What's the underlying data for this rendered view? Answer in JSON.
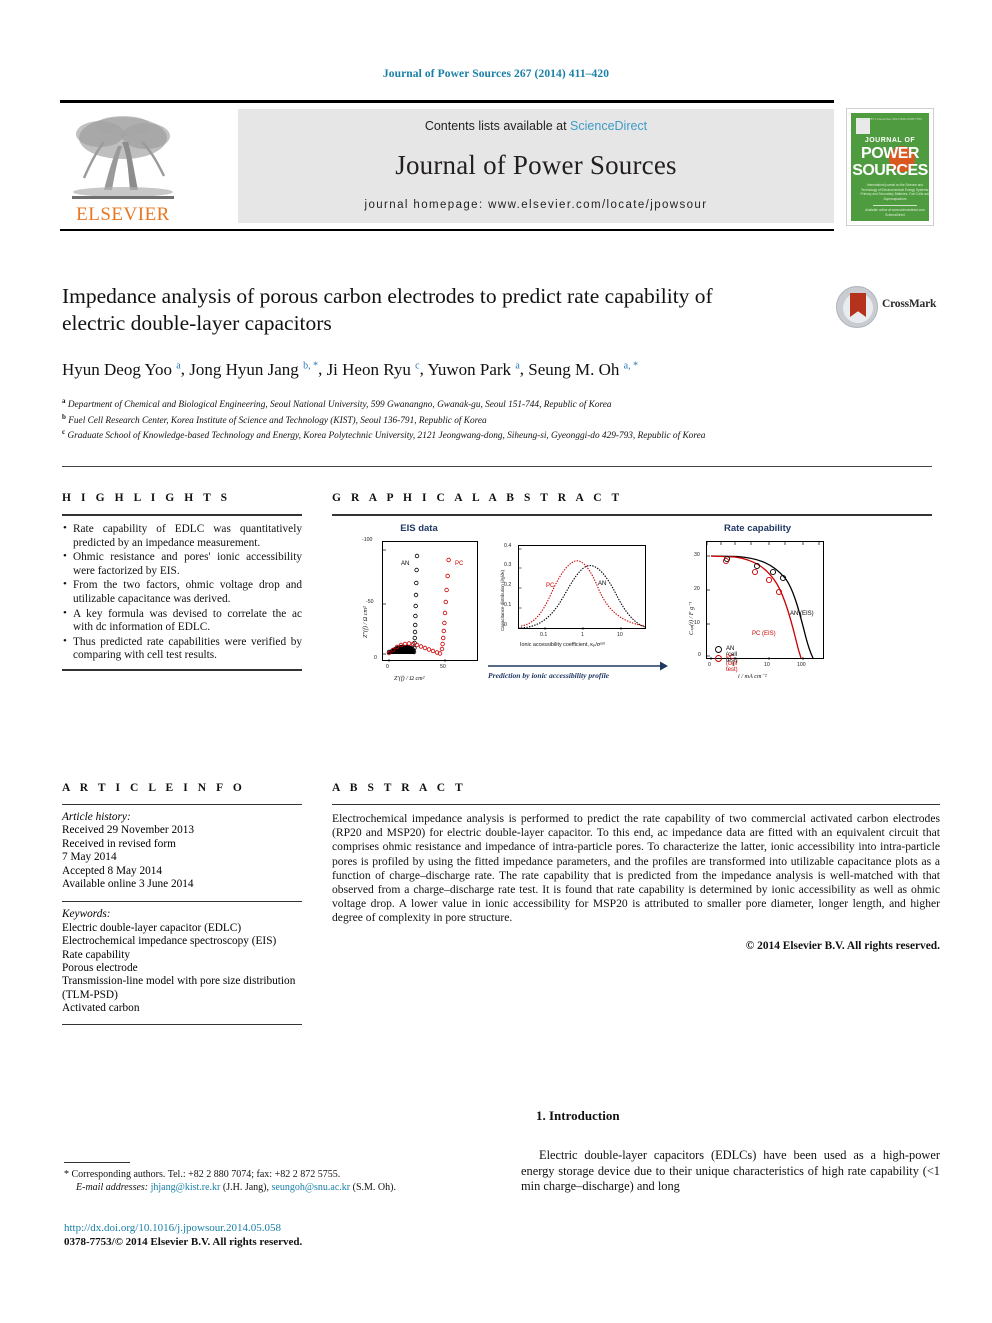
{
  "running_head": "Journal of Power Sources 267 (2014) 411–420",
  "masthead": {
    "contents_prefix": "Contents lists available at ",
    "sciencedirect": "ScienceDirect",
    "journal_name": "Journal of Power Sources",
    "homepage": "journal homepage: www.elsevier.com/locate/jpowsour",
    "publisher_logo_text": "ELSEVIER",
    "cover": {
      "top_text": "Volume 267  1 December 2014  ISSN 0378-7753",
      "journal_of": "JOURNAL OF",
      "power": "POWER",
      "sources": "SOURCES",
      "subtitle": "International journal on the Science and Technology of Electrochemical Energy Systems: Primary and Secondary Batteries, Fuel Cells and Supercapacitors",
      "footer": "Available online at www.sciencedirect.com  ScienceDirect"
    }
  },
  "article": {
    "title": "Impedance analysis of porous carbon electrodes to predict rate capability of electric double-layer capacitors",
    "authors": [
      {
        "name": "Hyun Deog Yoo",
        "marks": "a"
      },
      {
        "name": "Jong Hyun Jang",
        "marks": "b, *"
      },
      {
        "name": "Ji Heon Ryu",
        "marks": "c"
      },
      {
        "name": "Yuwon Park",
        "marks": "a"
      },
      {
        "name": "Seung M. Oh",
        "marks": "a, *"
      }
    ],
    "affiliations": [
      {
        "mark": "a",
        "text": "Department of Chemical and Biological Engineering, Seoul National University, 599 Gwanangno, Gwanak-gu, Seoul 151-744, Republic of Korea"
      },
      {
        "mark": "b",
        "text": "Fuel Cell Research Center, Korea Institute of Science and Technology (KIST), Seoul 136-791, Republic of Korea"
      },
      {
        "mark": "c",
        "text": "Graduate School of Knowledge-based Technology and Energy, Korea Polytechnic University, 2121 Jeongwang-dong, Siheung-si, Gyeonggi-do 429-793, Republic of Korea"
      }
    ],
    "crossmark_label": "CrossMark"
  },
  "highlights": {
    "heading": "H I G H L I G H T S",
    "items": [
      "Rate capability of EDLC was quantitatively predicted by an impedance measurement.",
      "Ohmic resistance and pores' ionic accessibility were factorized by EIS.",
      "From the two factors, ohmic voltage drop and utilizable capacitance was derived.",
      "A key formula was devised to correlate the ac with dc information of EDLC.",
      "Thus predicted rate capabilities were verified by comparing with cell test results."
    ]
  },
  "graphical_abstract": {
    "heading": "G R A P H I C A L   A B S T R A C T",
    "arrow_caption": "Prediction by ionic accessibility profile"
  },
  "article_info": {
    "heading": "A R T I C L E   I N F O",
    "history_label": "Article history:",
    "history": [
      "Received 29 November 2013",
      "Received in revised form",
      "7 May 2014",
      "Accepted 8 May 2014",
      "Available online 3 June 2014"
    ],
    "keywords_label": "Keywords:",
    "keywords": [
      "Electric double-layer capacitor (EDLC)",
      "Electrochemical impedance spectroscopy (EIS)",
      "Rate capability",
      "Porous electrode",
      "Transmission-line model with pore size distribution (TLM-PSD)",
      "Activated carbon"
    ]
  },
  "abstract": {
    "heading": "A B S T R A C T",
    "body": "Electrochemical impedance analysis is performed to predict the rate capability of two commercial activated carbon electrodes (RP20 and MSP20) for electric double-layer capacitor. To this end, ac impedance data are fitted with an equivalent circuit that comprises ohmic resistance and impedance of intra-particle pores. To characterize the latter, ionic accessibility into intra-particle pores is profiled by using the fitted impedance parameters, and the profiles are transformed into utilizable capacitance plots as a function of charge–discharge rate. The rate capability that is predicted from the impedance analysis is well-matched with that observed from a charge–discharge rate test. It is found that rate capability is determined by ionic accessibility as well as ohmic voltage drop. A lower value in ionic accessibility for MSP20 is attributed to smaller pore diameter, longer length, and higher degree of complexity in pore structure.",
    "copyright": "© 2014 Elsevier B.V. All rights reserved."
  },
  "footnotes": {
    "corresponding": "Corresponding authors. Tel.: +82 2 880 7074; fax: +82 2 872 5755.",
    "email_label": "E-mail addresses:",
    "email1": "jhjang@kist.re.kr",
    "email1_who": "(J.H. Jang),",
    "email2": "seungoh@snu.ac.kr",
    "email2_who": "(S.M. Oh).",
    "doi": "http://dx.doi.org/10.1016/j.jpowsour.2014.05.058",
    "issn": "0378-7753/© 2014 Elsevier B.V. All rights reserved."
  },
  "introduction": {
    "heading": "1. Introduction",
    "body": "Electric double-layer capacitors (EDLCs) have been used as a high-power energy storage device due to their unique characteristics of high rate capability (<1 min charge–discharge) and long"
  },
  "colors": {
    "link": "#1a7fa8",
    "sciencedirect": "#3d9cc8",
    "elsevier_orange": "#e87722",
    "cover_green": "#4e9c3f",
    "panel_title": "#1f3864",
    "series_an": "#000000",
    "series_pc": "#cc0000"
  },
  "chart_data": [
    {
      "type": "scatter",
      "title": "EIS data",
      "xlabel": "Z'(f) / Ω cm²",
      "ylabel": "Z\"(f) / Ω cm²",
      "xticks": [
        0,
        50
      ],
      "yticks": [
        0,
        -50,
        -100
      ],
      "xlim": [
        -5,
        62
      ],
      "ylim": [
        6,
        -105
      ],
      "legend_position": "inside",
      "series": [
        {
          "name": "AN",
          "color": "#000000",
          "marker": "open-circle",
          "points": [
            [
              1,
              0
            ],
            [
              2,
              1
            ],
            [
              3,
              1.5
            ],
            [
              4,
              2
            ],
            [
              5,
              2.5
            ],
            [
              6,
              3
            ],
            [
              7,
              3.2
            ],
            [
              8,
              3.5
            ],
            [
              9,
              3.4
            ],
            [
              10,
              3.2
            ],
            [
              11,
              3
            ],
            [
              12,
              2.6
            ],
            [
              13,
              2.2
            ],
            [
              14,
              1.8
            ],
            [
              15,
              1.2
            ],
            [
              16,
              0.6
            ],
            [
              16.5,
              -2
            ],
            [
              16.8,
              -5
            ],
            [
              17,
              -9
            ],
            [
              17.2,
              -13
            ],
            [
              17.4,
              -18
            ],
            [
              17.6,
              -24
            ],
            [
              17.8,
              -31
            ],
            [
              18,
              -40
            ],
            [
              18.2,
              -50
            ],
            [
              18.4,
              -62
            ],
            [
              18.6,
              -76
            ],
            [
              18.8,
              -88
            ]
          ]
        },
        {
          "name": "PC",
          "color": "#cc0000",
          "marker": "open-circle",
          "points": [
            [
              1,
              0
            ],
            [
              3,
              1.5
            ],
            [
              5,
              3
            ],
            [
              7,
              4
            ],
            [
              9,
              4.5
            ],
            [
              11,
              4.8
            ],
            [
              13,
              4.6
            ],
            [
              15,
              4.2
            ],
            [
              17,
              3.8
            ],
            [
              19,
              3.4
            ],
            [
              21,
              3
            ],
            [
              23,
              2.6
            ],
            [
              25,
              2.2
            ],
            [
              27,
              1.8
            ],
            [
              29,
              1.2
            ],
            [
              31,
              0.6
            ],
            [
              32,
              -3
            ],
            [
              32.5,
              -7
            ],
            [
              33,
              -12
            ],
            [
              33.5,
              -18
            ],
            [
              34,
              -25
            ],
            [
              34.5,
              -33
            ],
            [
              35,
              -42
            ],
            [
              35.6,
              -52
            ],
            [
              36.2,
              -64
            ],
            [
              37,
              -78
            ],
            [
              37.8,
              -90
            ]
          ]
        }
      ]
    },
    {
      "type": "line",
      "title": "",
      "xlabel": "Ionic accessibility coefficient, κₚ/σˢᵒˡ",
      "ylabel": "Capacitance distribution (∂χ/∂κ)",
      "xticks": [
        "0.1",
        "1",
        "10"
      ],
      "yticks": [
        0.0,
        0.1,
        0.2,
        0.3,
        0.4
      ],
      "xscale": "log",
      "ylim": [
        0,
        0.4
      ],
      "series": [
        {
          "name": "PC",
          "color": "#cc0000",
          "x": [
            0.05,
            0.08,
            0.12,
            0.2,
            0.3,
            0.45,
            0.7,
            1.0,
            1.5,
            2.2,
            3.5,
            5.0,
            8.0,
            15,
            30
          ],
          "y": [
            0.005,
            0.01,
            0.03,
            0.07,
            0.14,
            0.23,
            0.29,
            0.3,
            0.25,
            0.16,
            0.08,
            0.04,
            0.02,
            0.008,
            0.004
          ]
        },
        {
          "name": "AN",
          "color": "#000000",
          "x": [
            0.05,
            0.08,
            0.12,
            0.2,
            0.3,
            0.45,
            0.7,
            1.0,
            1.5,
            2.2,
            3.5,
            5.0,
            8.0,
            15,
            30
          ],
          "y": [
            0.003,
            0.006,
            0.012,
            0.03,
            0.07,
            0.14,
            0.23,
            0.28,
            0.27,
            0.21,
            0.13,
            0.07,
            0.03,
            0.012,
            0.005
          ]
        }
      ]
    },
    {
      "type": "line",
      "title": "Rate capability",
      "xlabel": "i / mA cm⁻²",
      "ylabel": "Cₛₚ(i) / F g⁻¹",
      "xticks": [
        "0",
        "1",
        "10",
        "100"
      ],
      "yticks": [
        0,
        10,
        20,
        30
      ],
      "xscale": "log",
      "ylim": [
        -2,
        34
      ],
      "legend": [
        "AN (cell test)",
        "PC (cell test)"
      ],
      "annotations": [
        "AN (EIS)",
        "PC (EIS)"
      ],
      "series": [
        {
          "name": "AN (EIS)",
          "color": "#000000",
          "kind": "curve",
          "x": [
            0.3,
            1,
            3,
            10,
            20,
            40,
            70,
            120,
            200,
            300
          ],
          "y": [
            29.8,
            29.6,
            28.8,
            27.0,
            25.3,
            22.5,
            18.5,
            11.0,
            2.0,
            -1.0
          ]
        },
        {
          "name": "PC (EIS)",
          "color": "#cc0000",
          "kind": "curve",
          "x": [
            0.3,
            1,
            3,
            10,
            20,
            40,
            70,
            120,
            200
          ],
          "y": [
            29.8,
            29.4,
            28.0,
            25.3,
            23.0,
            19.5,
            14.5,
            6.0,
            -1.0
          ]
        },
        {
          "name": "AN (cell test)",
          "color": "#000000",
          "kind": "points",
          "x": [
            0.8,
            6,
            20,
            45
          ],
          "y": [
            29.0,
            27.0,
            25.5,
            24.0
          ]
        },
        {
          "name": "PC (cell test)",
          "color": "#cc0000",
          "kind": "points",
          "x": [
            0.8,
            6,
            20,
            45
          ],
          "y": [
            28.5,
            25.8,
            23.2,
            19.5
          ]
        }
      ]
    }
  ]
}
